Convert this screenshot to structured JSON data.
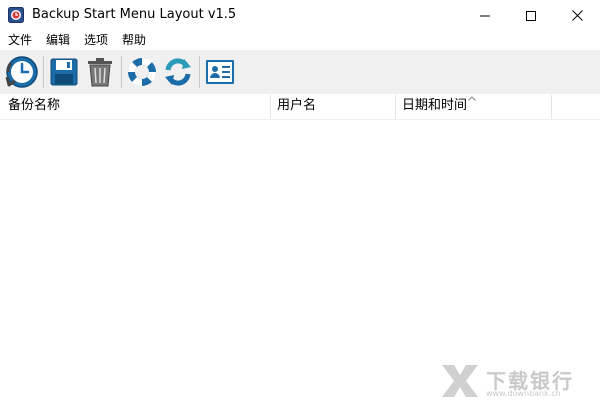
{
  "window": {
    "title": "Backup Start Menu Layout v1.5",
    "icon": "app-icon"
  },
  "controls": {
    "minimize_icon": "minimize-icon",
    "maximize_icon": "maximize-icon",
    "close_icon": "close-icon"
  },
  "menu": {
    "items": [
      {
        "label": "文件"
      },
      {
        "label": "编辑"
      },
      {
        "label": "选项"
      },
      {
        "label": "帮助"
      }
    ]
  },
  "toolbar": {
    "buttons": [
      {
        "icon": "backup-clock-icon"
      },
      {
        "icon": "save-icon"
      },
      {
        "icon": "delete-trash-icon"
      },
      {
        "icon": "help-lifebuoy-icon"
      },
      {
        "icon": "refresh-icon"
      },
      {
        "icon": "contact-card-icon"
      }
    ]
  },
  "list": {
    "columns": [
      {
        "label": "备份名称"
      },
      {
        "label": "用户名"
      },
      {
        "label": "日期和时间"
      }
    ],
    "rows": []
  },
  "watermark": {
    "text": "下载银行",
    "url": "www.downbank.cn"
  },
  "colors": {
    "toolbar_bg": "#f0f0f0",
    "icon_blue": "#1b6ca8",
    "icon_teal": "#2a9bb8",
    "icon_gray": "#666666",
    "watermark": "#c9c9c9"
  }
}
